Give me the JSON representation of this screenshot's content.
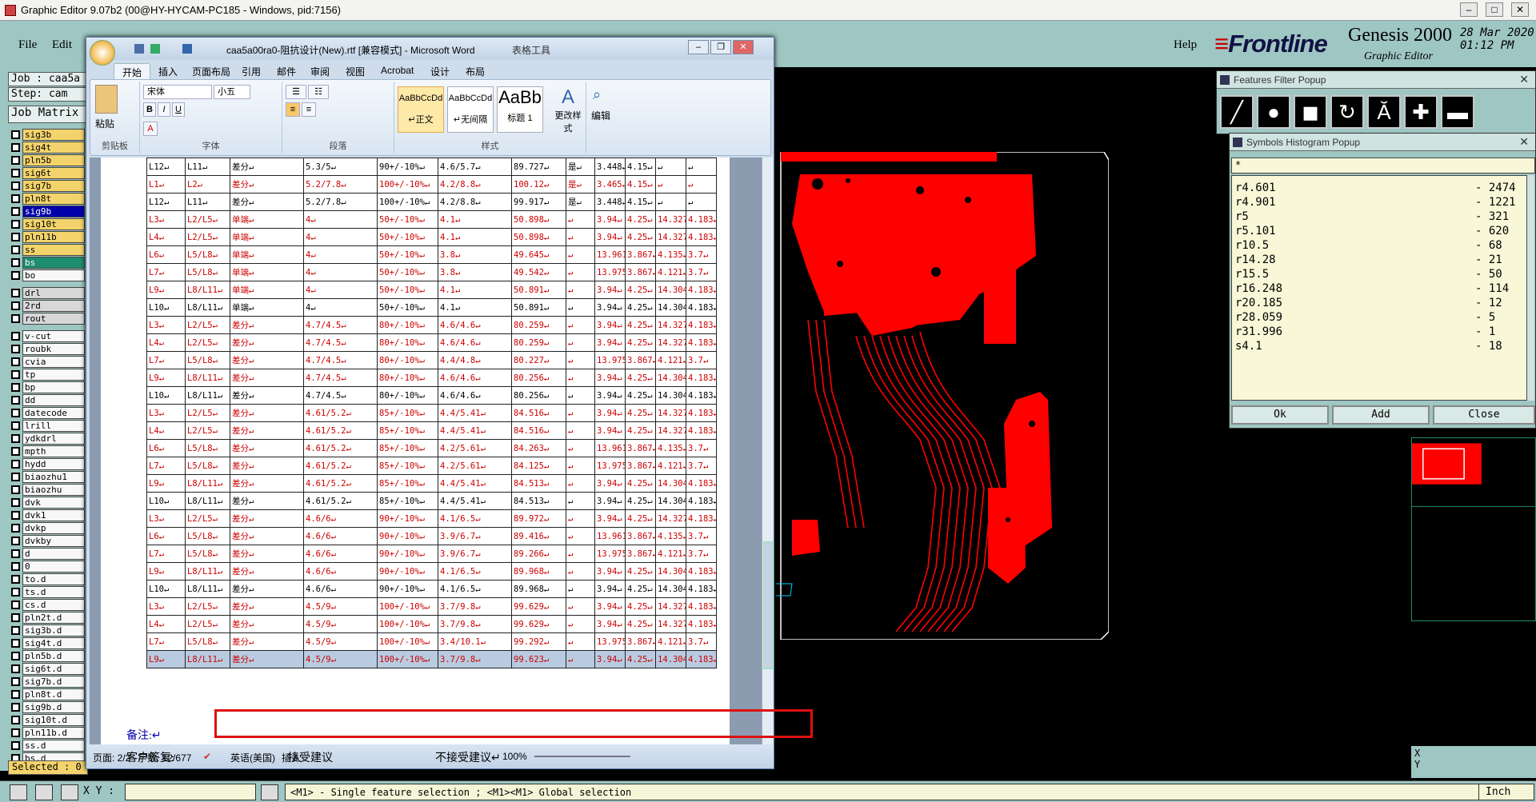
{
  "genesis": {
    "title": "Graphic Editor 9.07b2 (00@HY-HYCAM-PC185 - Windows, pid:7156)",
    "menu": {
      "file": "File",
      "edit": "Edit",
      "help": "Help"
    },
    "brand": {
      "logo_a": "Front",
      "logo_b": "line",
      "product": "Genesis 2000",
      "subtitle": "Graphic Editor",
      "date": "28 Mar 2020",
      "time": "01:12 PM"
    },
    "job_label": "Job : caa5a",
    "step_label": "Step: cam",
    "job_matrix": "Job Matrix",
    "layers_a": [
      "sig3b",
      "sig4t",
      "pln5b",
      "sig6t",
      "sig7b",
      "pln8t",
      "sig9b",
      "sig10t",
      "pln11b",
      "ss",
      "bs",
      "bo"
    ],
    "layers_b": [
      "drl",
      "2rd",
      "rout"
    ],
    "layers_c": [
      "v-cut",
      "roubk",
      "cvia",
      "tp",
      "bp",
      "dd",
      "datecode",
      "lrill",
      "ydkdrl",
      "mpth",
      "hydd",
      "biaozhu1",
      "biaozhu",
      "dvk",
      "dvk1",
      "dvkp",
      "dvkby",
      "d",
      "0",
      "to.d",
      "ts.d",
      "cs.d",
      "pln2t.d",
      "sig3b.d",
      "sig4t.d",
      "pln5b.d",
      "sig6t.d",
      "sig7b.d",
      "pln8t.d",
      "sig9b.d",
      "sig10t.d",
      "pln11b.d",
      "ss.d",
      "bs.d"
    ],
    "selected": "Selected : 0",
    "xy_label": "X Y :",
    "message": "<M1> - Single feature selection ; <M1><M1> Global selection",
    "units": "Inch",
    "xy_info": "X\nY",
    "colors": {
      "panel": "#9ec6c2",
      "board": "#ff0000",
      "accent": "#c00000"
    }
  },
  "features_popup": {
    "title": "Features Filter Popup",
    "buttons": [
      "line-icon",
      "pad-icon",
      "surface-icon",
      "arc-icon",
      "text-icon",
      "plus-icon",
      "minus-icon"
    ]
  },
  "symbols_popup": {
    "title": "Symbols Histogram Popup",
    "filter": "*",
    "rows": [
      {
        "sym": "r4.601",
        "count": "- 2474"
      },
      {
        "sym": "r4.901",
        "count": "- 1221"
      },
      {
        "sym": "r5",
        "count": "- 321"
      },
      {
        "sym": "r5.101",
        "count": "- 620"
      },
      {
        "sym": "r10.5",
        "count": "- 68"
      },
      {
        "sym": "r14.28",
        "count": "- 21"
      },
      {
        "sym": "r15.5",
        "count": "- 50"
      },
      {
        "sym": "r16.248",
        "count": "- 114"
      },
      {
        "sym": "r20.185",
        "count": "- 12"
      },
      {
        "sym": "r28.059",
        "count": "- 5"
      },
      {
        "sym": "r31.996",
        "count": "- 1"
      },
      {
        "sym": "s4.1",
        "count": "- 18"
      }
    ],
    "ok": "Ok",
    "add": "Add",
    "close": "Close"
  },
  "word": {
    "title": "caa5a00ra0-阻抗设计(New).rtf [兼容模式] - Microsoft Word",
    "context": "表格工具",
    "tabs": [
      "开始",
      "插入",
      "页面布局",
      "引用",
      "邮件",
      "审阅",
      "视图",
      "Acrobat",
      "设计",
      "布局"
    ],
    "groups": {
      "clipboard": "剪贴板",
      "font": "字体",
      "paragraph": "段落",
      "styles": "样式",
      "edit": "编辑"
    },
    "paste": "粘贴",
    "font_name": "宋体",
    "font_size": "小五",
    "styles": [
      {
        "sample": "AaBbCcDd",
        "name": "↵正文"
      },
      {
        "sample": "AaBbCcDd",
        "name": "↵无间隔"
      },
      {
        "sample": "AaBb",
        "name": "标题 1"
      }
    ],
    "change_styles": "更改样式",
    "edit_btn": "编辑",
    "rows": [
      {
        "c": "b",
        "v": [
          "L12↵",
          "L11↵",
          "差分↵",
          "5.3/5↵",
          "90+/-10%↵",
          "4.6/5.7↵",
          "89.727↵",
          "是↵",
          "3.448↵",
          "4.15↵",
          "↵",
          "↵"
        ]
      },
      {
        "c": "r",
        "v": [
          "L1↵",
          "L2↵",
          "差分↵",
          "5.2/7.8↵",
          "100+/-10%↵",
          "4.2/8.8↵",
          "100.12↵",
          "是↵",
          "3.465↵",
          "4.15↵",
          "↵",
          "↵"
        ]
      },
      {
        "c": "b",
        "v": [
          "L12↵",
          "L11↵",
          "差分↵",
          "5.2/7.8↵",
          "100+/-10%↵",
          "4.2/8.8↵",
          "99.917↵",
          "是↵",
          "3.448↵",
          "4.15↵",
          "↵",
          "↵"
        ]
      },
      {
        "c": "r",
        "v": [
          "L3↵",
          "L2/L5↵",
          "单端↵",
          "4↵",
          "50+/-10%↵",
          "4.1↵",
          "50.898↵",
          "↵",
          "3.94↵",
          "4.25↵",
          "14.327↵",
          "4.183↵"
        ]
      },
      {
        "c": "r",
        "v": [
          "L4↵",
          "L2/L5↵",
          "单端↵",
          "4↵",
          "50+/-10%↵",
          "4.1↵",
          "50.898↵",
          "↵",
          "3.94↵",
          "4.25↵",
          "14.327↵",
          "4.183↵"
        ]
      },
      {
        "c": "r",
        "v": [
          "L6↵",
          "L5/L8↵",
          "单端↵",
          "4↵",
          "50+/-10%↵",
          "3.8↵",
          "49.645↵",
          "↵",
          "13.961↵",
          "3.867↵",
          "4.135↵",
          "3.7↵"
        ]
      },
      {
        "c": "r",
        "v": [
          "L7↵",
          "L5/L8↵",
          "单端↵",
          "4↵",
          "50+/-10%↵",
          "3.8↵",
          "49.542↵",
          "↵",
          "13.975↵",
          "3.867↵",
          "4.121↵",
          "3.7↵"
        ]
      },
      {
        "c": "r",
        "v": [
          "L9↵",
          "L8/L11↵",
          "单端↵",
          "4↵",
          "50+/-10%↵",
          "4.1↵",
          "50.891↵",
          "↵",
          "3.94↵",
          "4.25↵",
          "14.304↵",
          "4.183↵"
        ]
      },
      {
        "c": "b",
        "v": [
          "L10↵",
          "L8/L11↵",
          "单端↵",
          "4↵",
          "50+/-10%↵",
          "4.1↵",
          "50.891↵",
          "↵",
          "3.94↵",
          "4.25↵",
          "14.304↵",
          "4.183↵"
        ]
      },
      {
        "c": "r",
        "v": [
          "L3↵",
          "L2/L5↵",
          "差分↵",
          "4.7/4.5↵",
          "80+/-10%↵",
          "4.6/4.6↵",
          "80.259↵",
          "↵",
          "3.94↵",
          "4.25↵",
          "14.327↵",
          "4.183↵"
        ]
      },
      {
        "c": "r",
        "v": [
          "L4↵",
          "L2/L5↵",
          "差分↵",
          "4.7/4.5↵",
          "80+/-10%↵",
          "4.6/4.6↵",
          "80.259↵",
          "↵",
          "3.94↵",
          "4.25↵",
          "14.327↵",
          "4.183↵"
        ]
      },
      {
        "c": "r",
        "v": [
          "L7↵",
          "L5/L8↵",
          "差分↵",
          "4.7/4.5↵",
          "80+/-10%↵",
          "4.4/4.8↵",
          "80.227↵",
          "↵",
          "13.975↵",
          "3.867↵",
          "4.121↵",
          "3.7↵"
        ]
      },
      {
        "c": "r",
        "v": [
          "L9↵",
          "L8/L11↵",
          "差分↵",
          "4.7/4.5↵",
          "80+/-10%↵",
          "4.6/4.6↵",
          "80.256↵",
          "↵",
          "3.94↵",
          "4.25↵",
          "14.304↵",
          "4.183↵"
        ]
      },
      {
        "c": "b",
        "v": [
          "L10↵",
          "L8/L11↵",
          "差分↵",
          "4.7/4.5↵",
          "80+/-10%↵",
          "4.6/4.6↵",
          "80.256↵",
          "↵",
          "3.94↵",
          "4.25↵",
          "14.304↵",
          "4.183↵"
        ]
      },
      {
        "c": "r",
        "v": [
          "L3↵",
          "L2/L5↵",
          "差分↵",
          "4.61/5.2↵",
          "85+/-10%↵",
          "4.4/5.41↵",
          "84.516↵",
          "↵",
          "3.94↵",
          "4.25↵",
          "14.327↵",
          "4.183↵"
        ]
      },
      {
        "c": "r",
        "v": [
          "L4↵",
          "L2/L5↵",
          "差分↵",
          "4.61/5.2↵",
          "85+/-10%↵",
          "4.4/5.41↵",
          "84.516↵",
          "↵",
          "3.94↵",
          "4.25↵",
          "14.327↵",
          "4.183↵"
        ]
      },
      {
        "c": "r",
        "v": [
          "L6↵",
          "L5/L8↵",
          "差分↵",
          "4.61/5.2↵",
          "85+/-10%↵",
          "4.2/5.61↵",
          "84.263↵",
          "↵",
          "13.961↵",
          "3.867↵",
          "4.135↵",
          "3.7↵"
        ]
      },
      {
        "c": "r",
        "v": [
          "L7↵",
          "L5/L8↵",
          "差分↵",
          "4.61/5.2↵",
          "85+/-10%↵",
          "4.2/5.61↵",
          "84.125↵",
          "↵",
          "13.975↵",
          "3.867↵",
          "4.121↵",
          "3.7↵"
        ]
      },
      {
        "c": "r",
        "v": [
          "L9↵",
          "L8/L11↵",
          "差分↵",
          "4.61/5.2↵",
          "85+/-10%↵",
          "4.4/5.41↵",
          "84.513↵",
          "↵",
          "3.94↵",
          "4.25↵",
          "14.304↵",
          "4.183↵"
        ]
      },
      {
        "c": "b",
        "v": [
          "L10↵",
          "L8/L11↵",
          "差分↵",
          "4.61/5.2↵",
          "85+/-10%↵",
          "4.4/5.41↵",
          "84.513↵",
          "↵",
          "3.94↵",
          "4.25↵",
          "14.304↵",
          "4.183↵"
        ]
      },
      {
        "c": "r",
        "v": [
          "L3↵",
          "L2/L5↵",
          "差分↵",
          "4.6/6↵",
          "90+/-10%↵",
          "4.1/6.5↵",
          "89.972↵",
          "↵",
          "3.94↵",
          "4.25↵",
          "14.327↵",
          "4.183↵"
        ]
      },
      {
        "c": "r",
        "v": [
          "L6↵",
          "L5/L8↵",
          "差分↵",
          "4.6/6↵",
          "90+/-10%↵",
          "3.9/6.7↵",
          "89.416↵",
          "↵",
          "13.961↵",
          "3.867↵",
          "4.135↵",
          "3.7↵"
        ]
      },
      {
        "c": "r",
        "v": [
          "L7↵",
          "L5/L8↵",
          "差分↵",
          "4.6/6↵",
          "90+/-10%↵",
          "3.9/6.7↵",
          "89.266↵",
          "↵",
          "13.975↵",
          "3.867↵",
          "4.121↵",
          "3.7↵"
        ]
      },
      {
        "c": "r",
        "v": [
          "L9↵",
          "L8/L11↵",
          "差分↵",
          "4.6/6↵",
          "90+/-10%↵",
          "4.1/6.5↵",
          "89.968↵",
          "↵",
          "3.94↵",
          "4.25↵",
          "14.304↵",
          "4.183↵"
        ]
      },
      {
        "c": "b",
        "v": [
          "L10↵",
          "L8/L11↵",
          "差分↵",
          "4.6/6↵",
          "90+/-10%↵",
          "4.1/6.5↵",
          "89.968↵",
          "↵",
          "3.94↵",
          "4.25↵",
          "14.304↵",
          "4.183↵"
        ]
      },
      {
        "c": "r",
        "v": [
          "L3↵",
          "L2/L5↵",
          "差分↵",
          "4.5/9↵",
          "100+/-10%↵",
          "3.7/9.8↵",
          "99.629↵",
          "↵",
          "3.94↵",
          "4.25↵",
          "14.327↵",
          "4.183↵"
        ]
      },
      {
        "c": "r",
        "v": [
          "L4↵",
          "L2/L5↵",
          "差分↵",
          "4.5/9↵",
          "100+/-10%↵",
          "3.7/9.8↵",
          "99.629↵",
          "↵",
          "3.94↵",
          "4.25↵",
          "14.327↵",
          "4.183↵"
        ]
      },
      {
        "c": "r",
        "v": [
          "L7↵",
          "L5/L8↵",
          "差分↵",
          "4.5/9↵",
          "100+/-10%↵",
          "3.4/10.1↵",
          "99.292↵",
          "↵",
          "13.975↵",
          "3.867↵",
          "4.121↵",
          "3.7↵"
        ]
      },
      {
        "c": "hl",
        "v": [
          "L9↵",
          "L8/L11↵",
          "差分↵",
          "4.5/9↵",
          "100+/-10%↵",
          "3.7/9.8↵",
          "99.623↵",
          "↵",
          "3.94↵",
          "4.25↵",
          "14.304↵",
          "4.183↵"
        ]
      }
    ],
    "note": "备注:↵",
    "reply": "客户答复:",
    "accept": "接受建议",
    "reject": "不接受建议↵",
    "status": {
      "page": "页面: 2/2",
      "words": "字数: 12/677",
      "lang": "英语(美国)",
      "mode": "插入",
      "zoom": "100%"
    }
  }
}
